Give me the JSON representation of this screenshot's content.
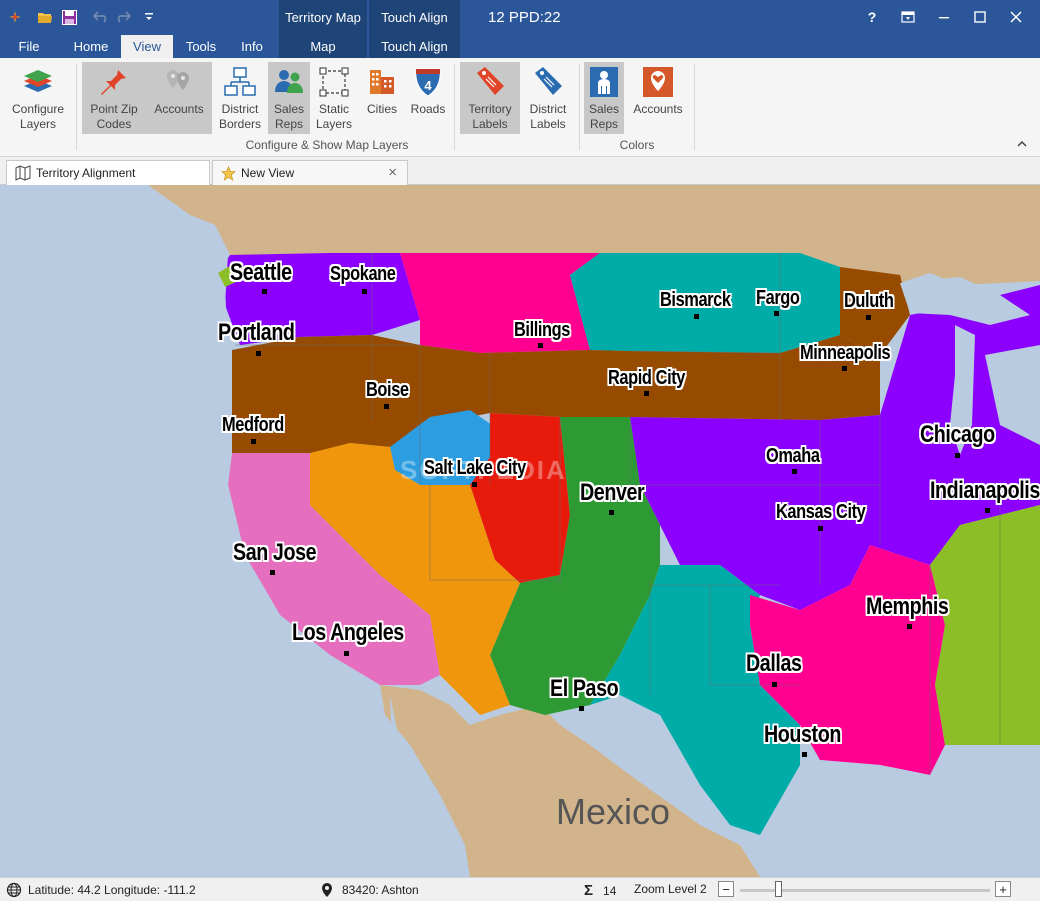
{
  "titlebar": {
    "title": "12 PPD:22",
    "context_tab_1_header": "Territory Map",
    "context_tab_2_header": "Touch Align",
    "help": "?",
    "icons": [
      "app-logo-icon",
      "open-folder-icon",
      "save-icon",
      "undo-icon",
      "redo-icon",
      "customize-qat-icon"
    ]
  },
  "tabs": {
    "file": "File",
    "home": "Home",
    "view": "View",
    "tools": "Tools",
    "info": "Info",
    "map": "Map",
    "touch_align": "Touch Align"
  },
  "ribbon": {
    "configure_layers": "Configure\nLayers",
    "point_zip_codes": "Point Zip\nCodes",
    "accounts": "Accounts",
    "district_borders": "District\nBorders",
    "sales_reps": "Sales\nReps",
    "static_layers": "Static\nLayers",
    "cities": "Cities",
    "roads": "Roads",
    "roads_shield_number": "4",
    "territory_labels": "Territory\nLabels",
    "district_labels": "District\nLabels",
    "colors_sales_reps": "Sales\nReps",
    "colors_accounts": "Accounts",
    "group_configure": "Configure & Show Map Layers",
    "group_colors": "Colors"
  },
  "doc_tabs": {
    "territory_alignment": "Territory Alignment",
    "new_view": "New View",
    "close": "×"
  },
  "map": {
    "cities": [
      "Seattle",
      "Spokane",
      "Portland",
      "Billings",
      "Bismarck",
      "Fargo",
      "Duluth",
      "Minneapolis",
      "Boise",
      "Rapid City",
      "Medford",
      "Chicago",
      "Salt Lake City",
      "Omaha",
      "Denver",
      "Indianapolis",
      "Kansas City",
      "San Jose",
      "Memphis",
      "Los Angeles",
      "Dallas",
      "El Paso",
      "Houston"
    ],
    "country_label": "Mexico",
    "watermark": "SOFTPEDIA",
    "colors": {
      "water": "#b8cbe0",
      "land": "#d2b48c",
      "purple": "#8b00ff",
      "magenta": "#ff0090",
      "teal": "#00aca8",
      "brown": "#964b00",
      "blue": "#2b9de0",
      "red": "#e81a0c",
      "green": "#2e9a34",
      "orange": "#f0960c",
      "pink": "#e66ebe",
      "lime": "#8cbe28"
    }
  },
  "status": {
    "lat_lon": "Latitude: 44.2 Longitude: -111.2",
    "zip": "83420: Ashton",
    "sigma_count": "14",
    "zoom_level": "Zoom Level 2",
    "minus": "−",
    "plus": "+",
    "zoom_fraction": 0.15
  }
}
